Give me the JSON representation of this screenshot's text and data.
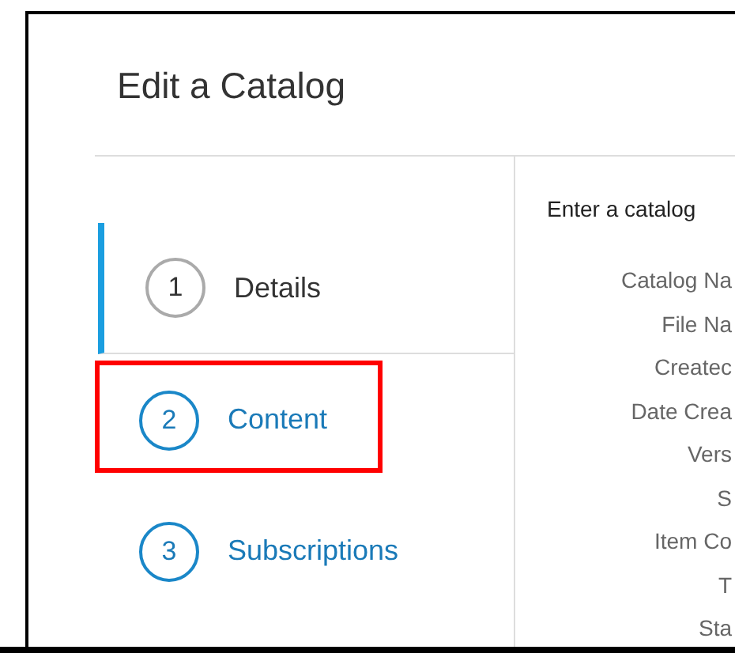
{
  "dialog": {
    "title": "Edit a Catalog"
  },
  "steps": [
    {
      "number": "1",
      "label": "Details",
      "selected": true,
      "highlighted": false
    },
    {
      "number": "2",
      "label": "Content",
      "selected": false,
      "highlighted": true
    },
    {
      "number": "3",
      "label": "Subscriptions",
      "selected": false,
      "highlighted": false
    }
  ],
  "form": {
    "instruction": "Enter a catalog",
    "fields": [
      "Catalog Na",
      "File Na",
      "Createc",
      "Date Crea",
      "Vers",
      "S",
      "Item Co",
      "T",
      "Sta"
    ]
  }
}
